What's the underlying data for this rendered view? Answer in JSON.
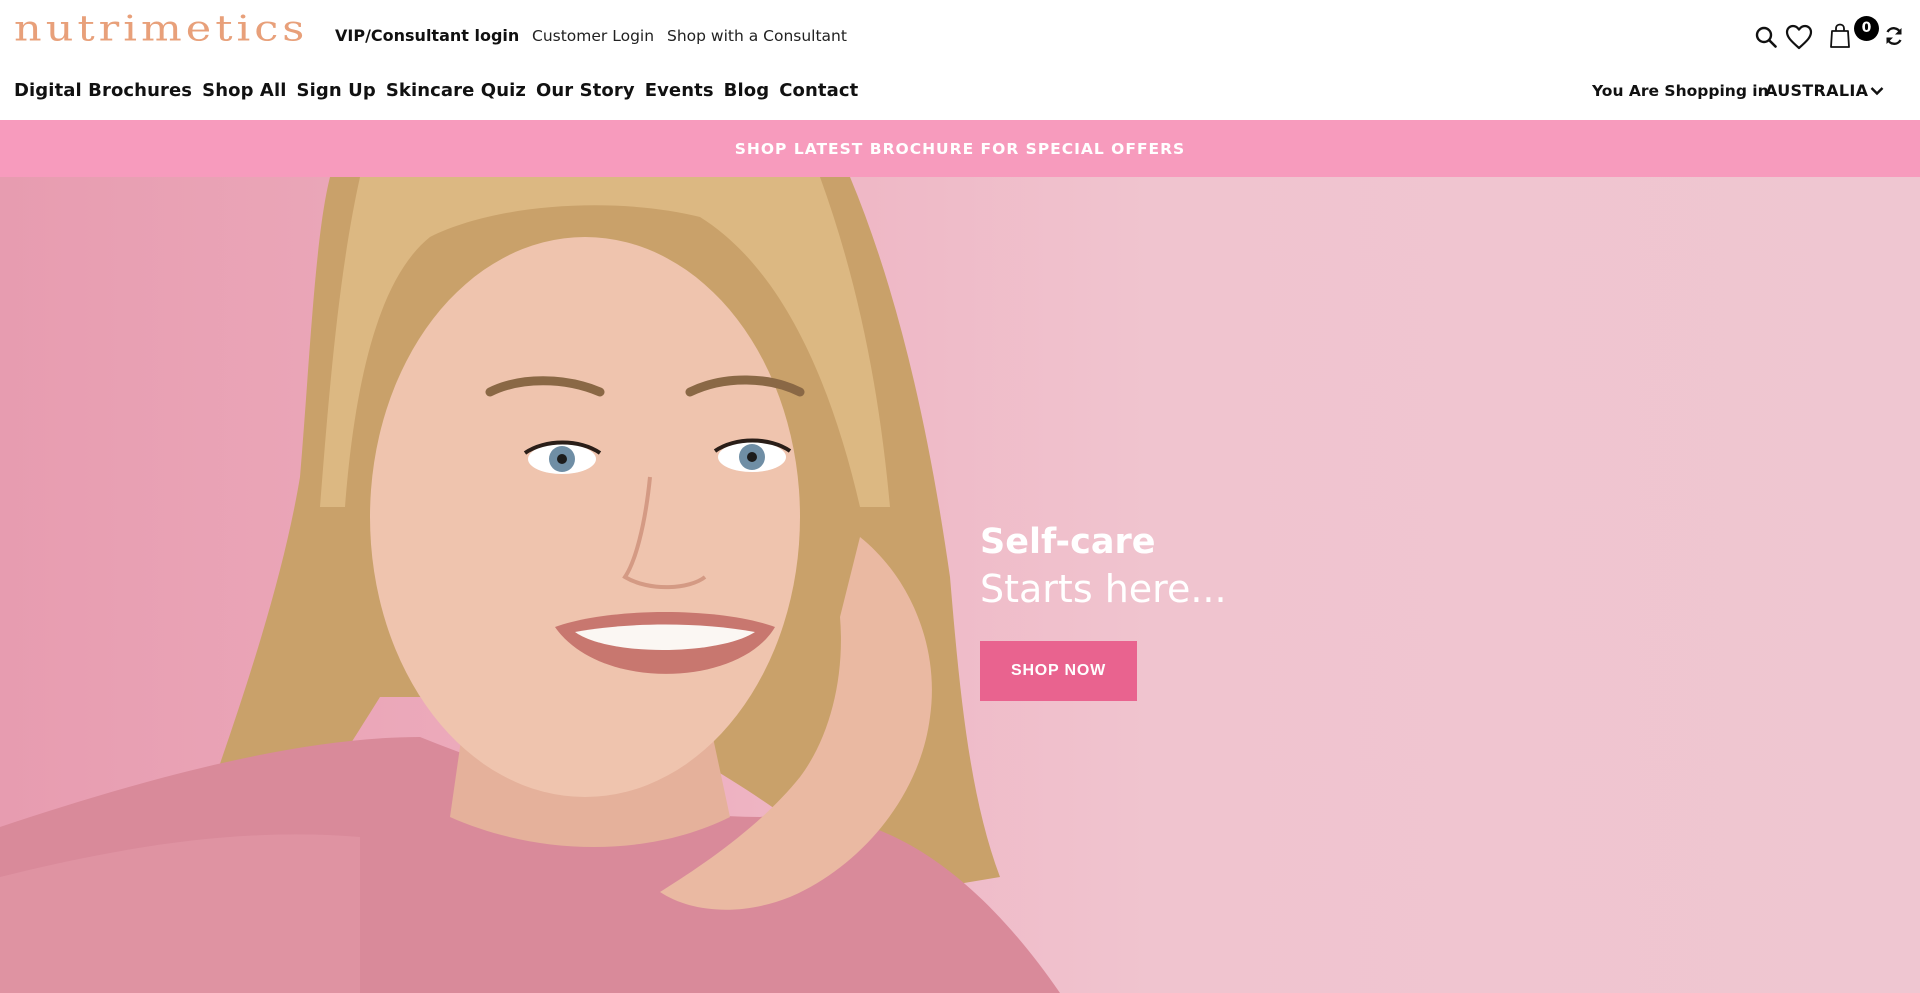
{
  "brand": {
    "logo_text": "nutrimetics",
    "logo_color": "#e8a07a"
  },
  "header": {
    "vip_login": "VIP/Consultant login",
    "customer_login": "Customer Login",
    "shop_with_consultant": "Shop with a Consultant",
    "cart_count": "0",
    "icons": [
      "search-icon",
      "heart-icon",
      "bag-icon",
      "refresh-icon"
    ]
  },
  "nav": {
    "items": [
      {
        "label": "Digital Brochures"
      },
      {
        "label": "Shop All"
      },
      {
        "label": "Sign Up"
      },
      {
        "label": "Skincare Quiz"
      },
      {
        "label": "Our Story"
      },
      {
        "label": "Events"
      },
      {
        "label": "Blog"
      },
      {
        "label": "Contact"
      }
    ],
    "shopping_in_label": "You Are Shopping in",
    "country": "AUSTRALIA"
  },
  "promo": {
    "text": "SHOP LATEST BROCHURE FOR SPECIAL OFFERS",
    "background": "#f79bbd"
  },
  "hero": {
    "heading": "Self-care",
    "subheading": "Starts here...",
    "cta_label": "SHOP NOW",
    "cta_color": "#e9638f"
  }
}
